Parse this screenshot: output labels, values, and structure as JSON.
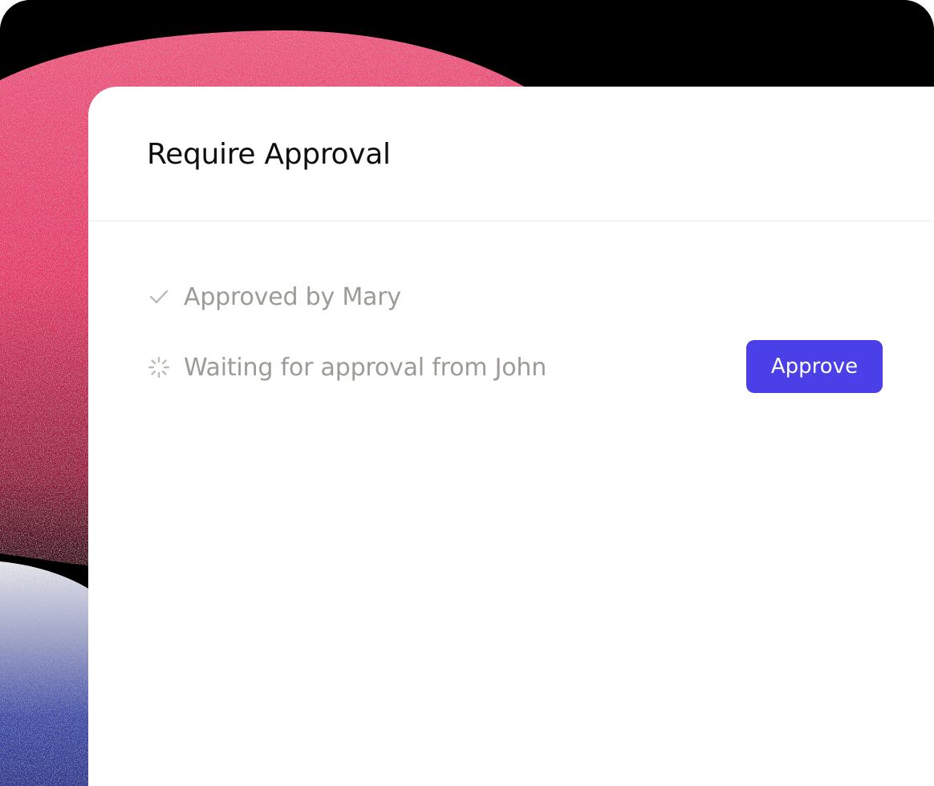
{
  "card": {
    "title": "Require Approval"
  },
  "approvals": [
    {
      "icon": "checkmark-icon",
      "text": "Approved by Mary",
      "status": "approved"
    },
    {
      "icon": "spinner-icon",
      "text": "Waiting for approval from John",
      "status": "pending"
    }
  ],
  "actions": {
    "approve_label": "Approve"
  },
  "colors": {
    "accent": "#4b3fe8",
    "muted_text": "#9e9a96",
    "title_text": "#0f0f0f",
    "backdrop_pink": "#e8386a",
    "backdrop_blue": "#3d4aa8"
  }
}
